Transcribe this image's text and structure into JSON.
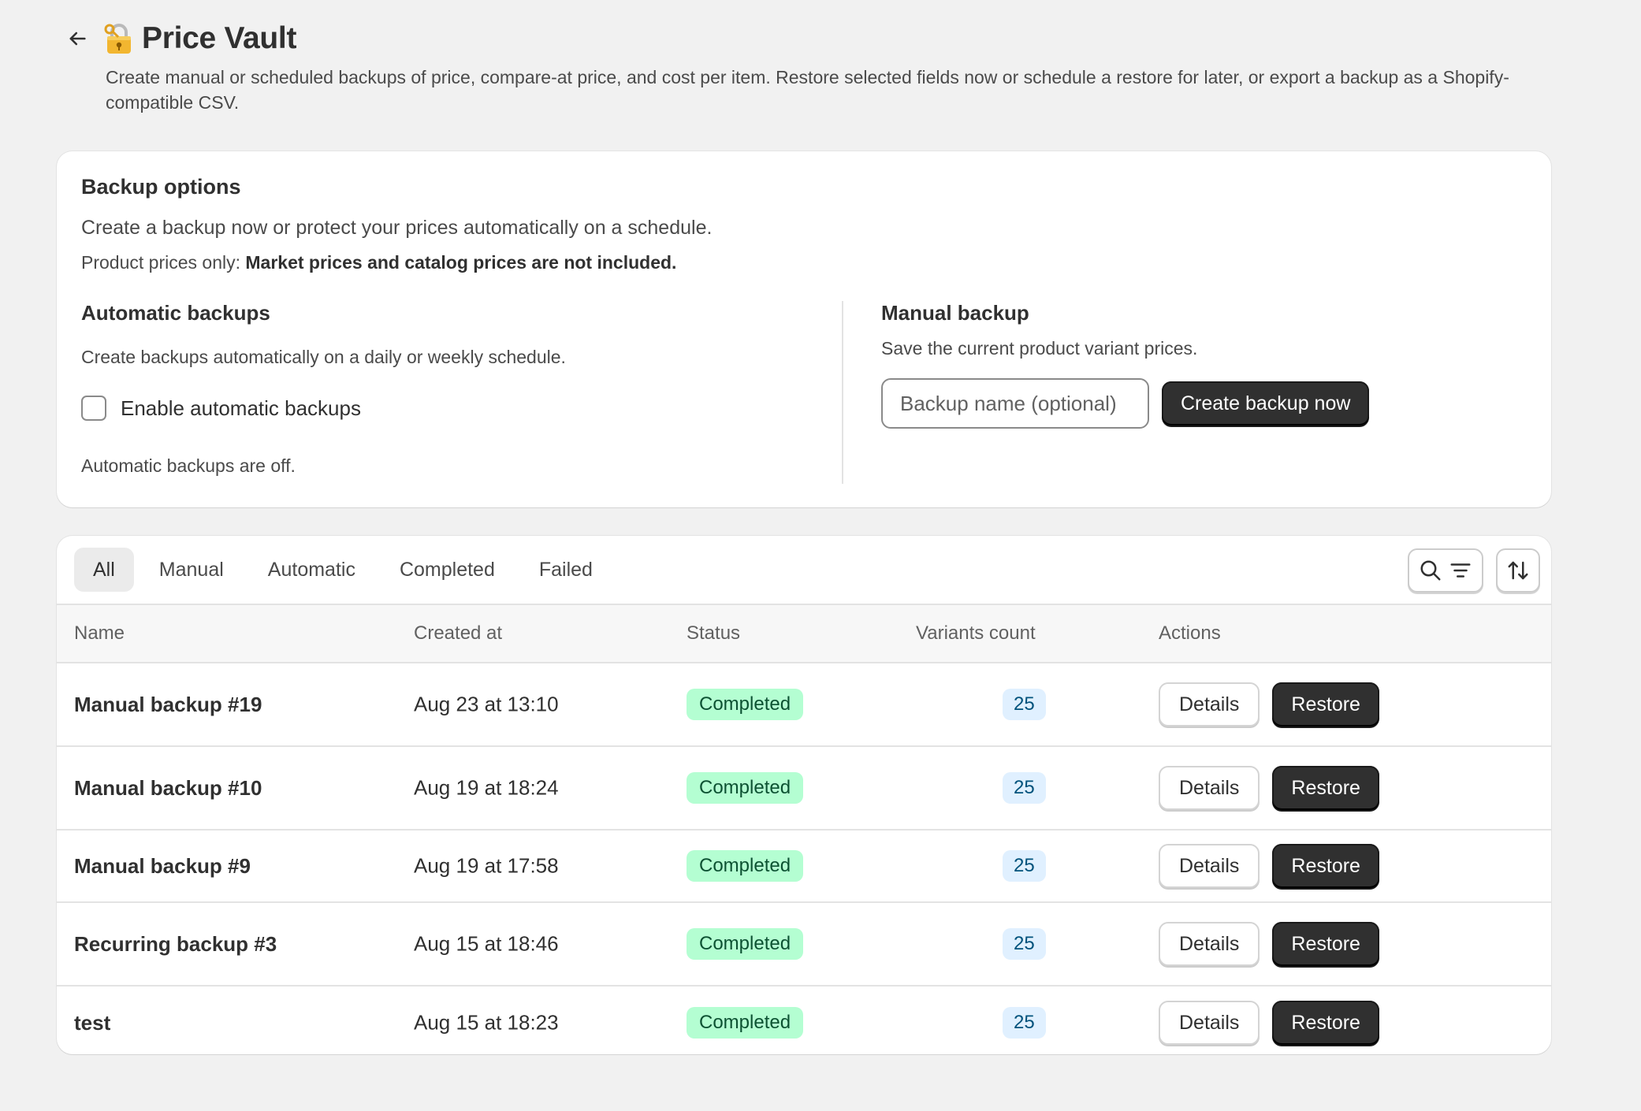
{
  "header": {
    "title": "Price Vault",
    "description": "Create manual or scheduled backups of price, compare-at price, and cost per item. Restore selected fields now or schedule a restore for later, or export a backup as a Shopify-compatible CSV."
  },
  "backup_options": {
    "title": "Backup options",
    "text": "Create a backup now or protect your prices automatically on a schedule.",
    "note_prefix": "Product prices only: ",
    "note_bold": "Market prices and catalog prices are not included.",
    "automatic": {
      "title": "Automatic backups",
      "text": "Create backups automatically on a daily or weekly schedule.",
      "checkbox_label": "Enable automatic backups",
      "status": "Automatic backups are off."
    },
    "manual": {
      "title": "Manual backup",
      "text": "Save the current product variant prices.",
      "input_placeholder": "Backup name (optional)",
      "create_label": "Create backup now"
    }
  },
  "tabs": [
    {
      "label": "All"
    },
    {
      "label": "Manual"
    },
    {
      "label": "Automatic"
    },
    {
      "label": "Completed"
    },
    {
      "label": "Failed"
    }
  ],
  "table": {
    "columns": {
      "name": "Name",
      "created": "Created at",
      "status": "Status",
      "variants": "Variants count",
      "actions": "Actions"
    },
    "rows": [
      {
        "name": "Manual backup #19",
        "created": "Aug 23 at 13:10",
        "status": "Completed",
        "variants": "25"
      },
      {
        "name": "Manual backup #10",
        "created": "Aug 19 at 18:24",
        "status": "Completed",
        "variants": "25"
      },
      {
        "name": "Manual backup #9",
        "created": "Aug 19 at 17:58",
        "status": "Completed",
        "variants": "25"
      },
      {
        "name": "Recurring backup #3",
        "created": "Aug 15 at 18:46",
        "status": "Completed",
        "variants": "25"
      },
      {
        "name": "test",
        "created": "Aug 15 at 18:23",
        "status": "Completed",
        "variants": "25"
      }
    ],
    "details_label": "Details",
    "restore_label": "Restore"
  },
  "icons": {
    "back": "arrow-left-icon",
    "title": "lock-with-key-icon",
    "search": "search-icon",
    "filter": "filter-icon",
    "sort": "sort-icon"
  },
  "colors": {
    "primary_button": "#303030",
    "completed_badge": "#b4fed2",
    "count_badge": "#e0f0ff",
    "background": "#f1f1f1"
  }
}
